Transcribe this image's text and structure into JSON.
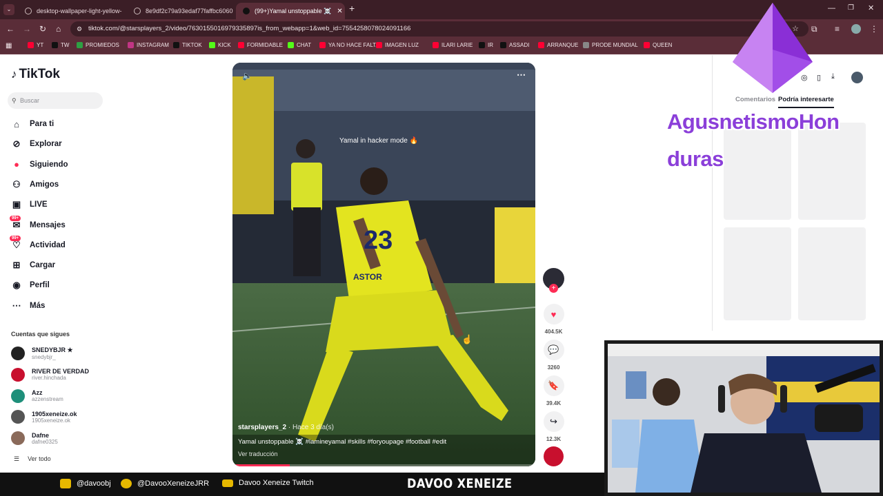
{
  "browser": {
    "tabs": [
      {
        "title": "desktop-wallpaper-light-yellow-",
        "active": false
      },
      {
        "title": "8e9df2c79a93edaf77faffbc6060",
        "active": false
      },
      {
        "title": "(99+)Yamal unstoppable ☠️",
        "active": true
      }
    ],
    "new_tab": "+",
    "url": "tiktok.com/@starsplayers_2/video/7630155016979335897is_from_webapp=1&web_id=7554258078024091166",
    "bookmarks": [
      {
        "label": "YT",
        "color": "#ff0033"
      },
      {
        "label": "TW",
        "color": "#111111"
      },
      {
        "label": "PROMIEDOS",
        "color": "#2ea043"
      },
      {
        "label": "INSTAGRAM",
        "color": "#c13584"
      },
      {
        "label": "TIKTOK",
        "color": "#111111"
      },
      {
        "label": "KICK",
        "color": "#53fc18"
      },
      {
        "label": "FORMIDABLE",
        "color": "#ff0033"
      },
      {
        "label": "CHAT",
        "color": "#53fc18"
      },
      {
        "label": "YA NO HACE FALTA",
        "color": "#ff0033"
      },
      {
        "label": "IMAGEN LUZ",
        "color": "#ff0033"
      },
      {
        "label": "ILARI LARIE",
        "color": "#ff0033"
      },
      {
        "label": "IR",
        "color": "#111111"
      },
      {
        "label": "ASSADI",
        "color": "#111111"
      },
      {
        "label": "ARRANQUE",
        "color": "#ff0033"
      },
      {
        "label": "PRODE MUNDIAL",
        "color": "#888888"
      },
      {
        "label": "QUEEN",
        "color": "#ff0033"
      }
    ]
  },
  "sidebar": {
    "logo": "TikTok",
    "search_placeholder": "Buscar",
    "nav": [
      {
        "label": "Para ti",
        "icon": "home-icon"
      },
      {
        "label": "Explorar",
        "icon": "compass-icon"
      },
      {
        "label": "Siguiendo",
        "icon": "following-icon"
      },
      {
        "label": "Amigos",
        "icon": "friends-icon"
      },
      {
        "label": "LIVE",
        "icon": "live-icon"
      },
      {
        "label": "Mensajes",
        "icon": "messages-icon",
        "badge": "99+"
      },
      {
        "label": "Actividad",
        "icon": "activity-icon",
        "badge": "99+"
      },
      {
        "label": "Cargar",
        "icon": "upload-icon"
      },
      {
        "label": "Perfil",
        "icon": "profile-icon"
      },
      {
        "label": "Más",
        "icon": "more-icon"
      }
    ],
    "following_title": "Cuentas que sigues",
    "following": [
      {
        "name": "SNEDYBJR ★",
        "user": "snedybjr_",
        "color": "#222222"
      },
      {
        "name": "RIVER DE VERDAD",
        "user": "river.hinchada",
        "color": "#c8102e"
      },
      {
        "name": "Azz",
        "user": "azzenstream",
        "color": "#1e8f7a"
      },
      {
        "name": "1905xeneize.ok",
        "user": "1905xeneize.ok",
        "color": "#555555"
      },
      {
        "name": "Dafne",
        "user": "dafne0325",
        "color": "#8a6a5a"
      }
    ],
    "see_all": "Ver todo"
  },
  "video": {
    "caption_overlay": "Yamal in hacker mode 🔥",
    "author": "starsplayers_2",
    "posted": "· Hace 3 día(s)",
    "description": "Yamal unstoppable ☠️ #lamineyamal #skills #foryoupage #football #edit",
    "translate": "Ver traducción",
    "progress": 0.19
  },
  "actions": {
    "likes": "404.5K",
    "comments": "3260",
    "saves": "39.4K",
    "shares": "12.3K"
  },
  "right_panel": {
    "tabs": [
      "Comentarios",
      "Podría interesarte"
    ]
  },
  "stream_overlay": {
    "name": "AgusnetismoHon duras"
  },
  "footer": {
    "instagram": "@davoobj",
    "twitter": "@DavooXeneizeJRR",
    "youtube": "Davoo Xeneize Twitch",
    "brand": "DAVOO XENEIZE"
  }
}
